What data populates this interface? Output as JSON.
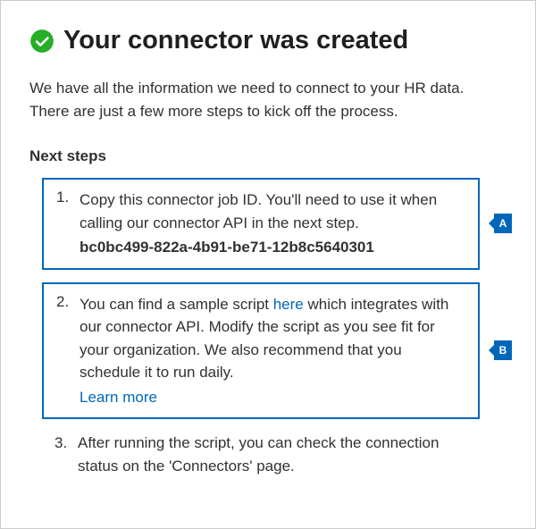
{
  "header": {
    "title": "Your connector was created"
  },
  "intro": "We have all the information we need to connect to your HR data. There are just a few more steps to kick off the process.",
  "nextStepsHeading": "Next steps",
  "callouts": {
    "a": "A",
    "b": "B"
  },
  "steps": {
    "step1": {
      "text": "Copy this connector job ID. You'll need to use it when calling our connector API in the next step.",
      "jobId": "bc0bc499-822a-4b91-be71-12b8c5640301"
    },
    "step2": {
      "textBefore": "You can find a sample script ",
      "linkText": "here",
      "textAfter": " which integrates with our connector API. Modify the script as you see fit for your organization. We also recommend that you schedule it to run daily.",
      "learnMore": "Learn more"
    },
    "step3": {
      "text": "After running the script, you can check the connection status on the 'Connectors' page."
    }
  }
}
